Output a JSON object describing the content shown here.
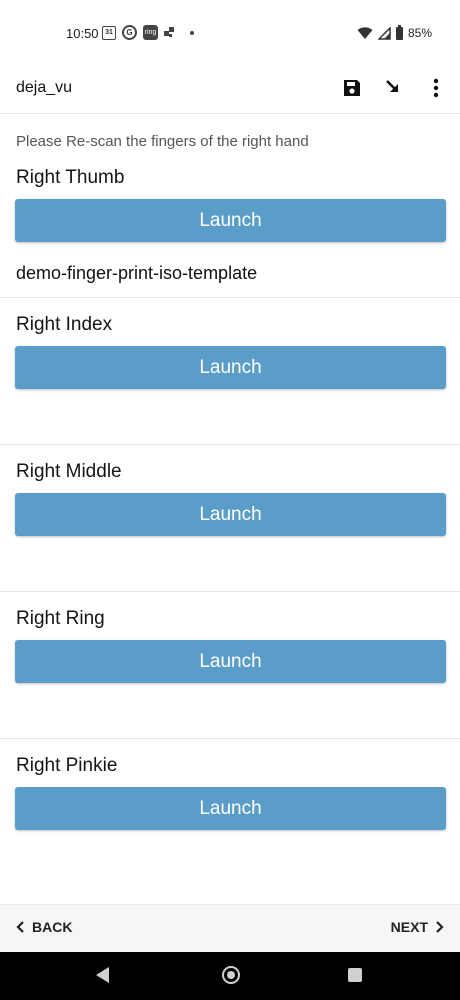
{
  "status_bar": {
    "time": "10:50",
    "calendar_day": "31",
    "ring_label": "ring",
    "battery_percent": "85%"
  },
  "app_bar": {
    "title": "deja_vu",
    "icons": [
      "save-icon",
      "download-arrow-icon",
      "more-vert-icon"
    ]
  },
  "content": {
    "instruction": "Please Re-scan the fingers of the right hand",
    "fingers": [
      {
        "label": "Right Thumb",
        "button": "Launch",
        "template": "demo-finger-print-iso-template"
      },
      {
        "label": "Right Index",
        "button": "Launch",
        "template": ""
      },
      {
        "label": "Right Middle",
        "button": "Launch",
        "template": ""
      },
      {
        "label": "Right Ring",
        "button": "Launch",
        "template": ""
      },
      {
        "label": "Right Pinkie",
        "button": "Launch",
        "template": ""
      }
    ]
  },
  "bottom_nav": {
    "back": "BACK",
    "next": "NEXT"
  },
  "colors": {
    "launch_button": "#5b9dc9",
    "nav_background": "#f6f6f6",
    "android_nav": "#000000"
  }
}
